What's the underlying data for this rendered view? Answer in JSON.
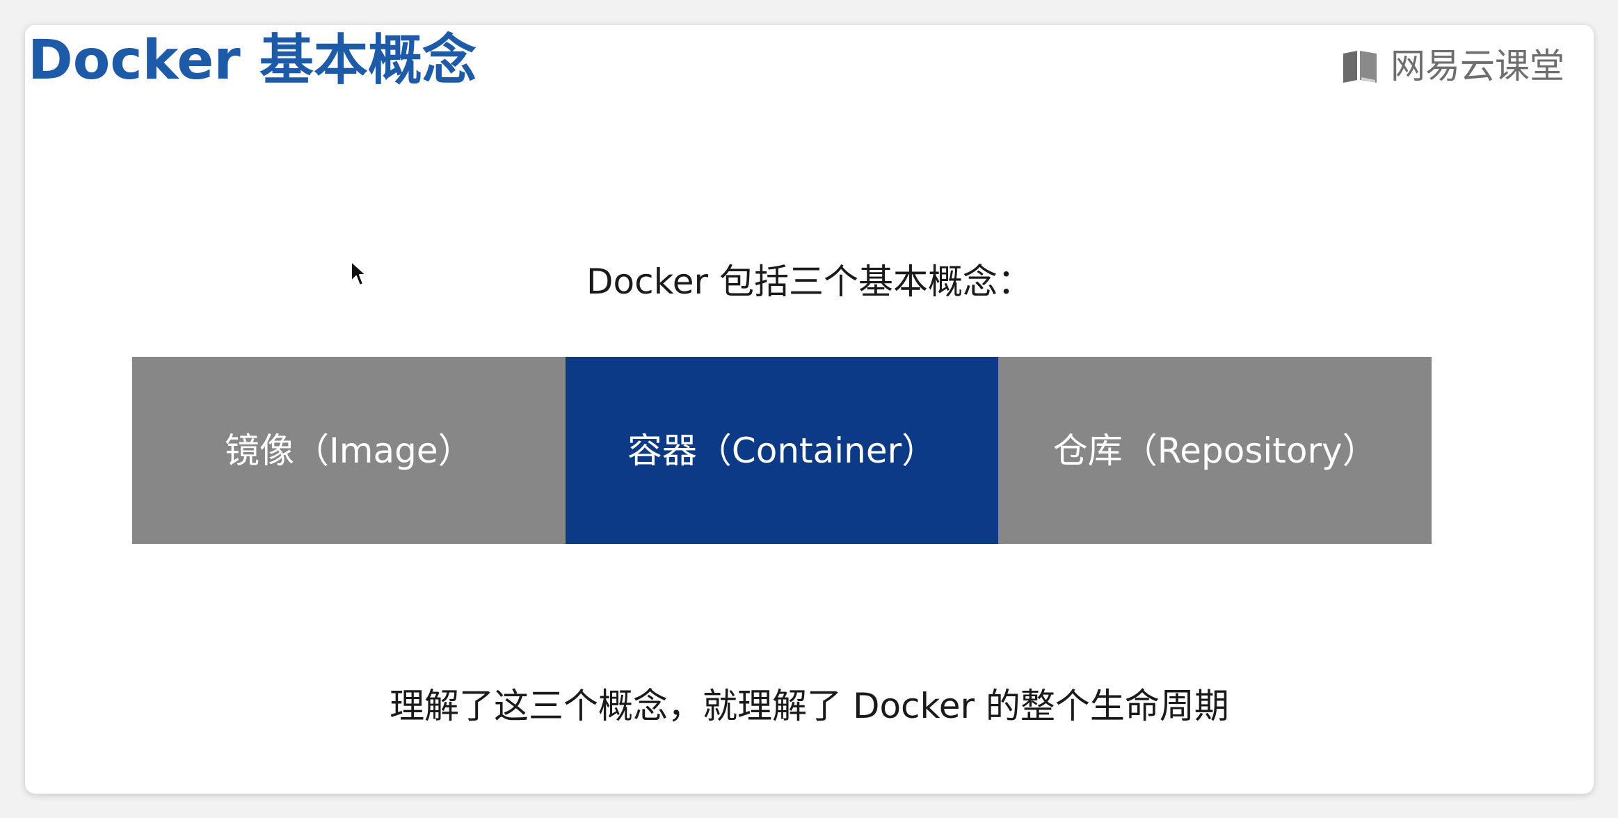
{
  "slide": {
    "title": "Docker 基本概念",
    "brand": {
      "icon": "book-logo-icon",
      "name": "网易云课堂"
    },
    "intro": "Docker 包括三个基本概念：",
    "concepts": [
      {
        "label": "镜像（Image）",
        "color": "#878787"
      },
      {
        "label": "容器（Container）",
        "color": "#0d3a86"
      },
      {
        "label": "仓库（Repository）",
        "color": "#878787"
      }
    ],
    "summary": "理解了这三个概念，就理解了 Docker 的整个生命周期"
  },
  "colors": {
    "title": "#1d5aa8",
    "highlight": "#0d3a86",
    "neutral": "#878787",
    "brand_text": "#6e6e6e"
  }
}
